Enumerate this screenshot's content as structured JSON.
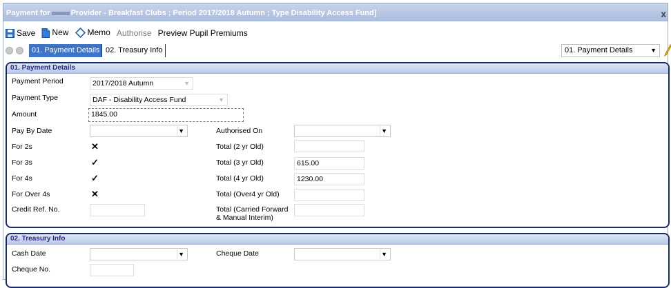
{
  "window": {
    "title_prefix": "Payment for",
    "title_suffix": "Provider - Breakfast Clubs ; Period 2017/2018 Autumn ; Type Disability Access Fund]",
    "close": "x"
  },
  "toolbar": {
    "save": "Save",
    "new": "New",
    "memo": "Memo",
    "authorise": "Authorise",
    "preview": "Preview Pupil Premiums"
  },
  "nav": {
    "tabs": [
      "01. Payment Details",
      "02. Treasury Info"
    ],
    "select_value": "01. Payment Details"
  },
  "payment_details": {
    "header": "01. Payment Details",
    "payment_period": {
      "label": "Payment Period",
      "value": "2017/2018 Autumn"
    },
    "payment_type": {
      "label": "Payment Type",
      "value": "DAF - Disability Access Fund"
    },
    "amount": {
      "label": "Amount",
      "value": "1845.00"
    },
    "pay_by_date": {
      "label": "Pay By Date",
      "value": ""
    },
    "authorised_on": {
      "label": "Authorised On",
      "value": ""
    },
    "for_2s": {
      "label": "For 2s",
      "checked": false
    },
    "for_3s": {
      "label": "For 3s",
      "checked": true
    },
    "for_4s": {
      "label": "For 4s",
      "checked": true
    },
    "for_over_4s": {
      "label": "For Over 4s",
      "checked": false
    },
    "total_2yr": {
      "label": "Total (2 yr Old)",
      "value": ""
    },
    "total_3yr": {
      "label": "Total (3 yr Old)",
      "value": "615.00"
    },
    "total_4yr": {
      "label": "Total (4 yr Old)",
      "value": "1230.00"
    },
    "total_over4": {
      "label": "Total (Over4 yr Old)",
      "value": ""
    },
    "credit_ref": {
      "label": "Credit Ref. No.",
      "value": ""
    },
    "total_cf_line1": "Total (Carried Forward",
    "total_cf_line2": "& Manual Interim)",
    "total_cf_value": ""
  },
  "treasury": {
    "header": "02. Treasury Info",
    "cash_date": {
      "label": "Cash Date",
      "value": ""
    },
    "cheque_date": {
      "label": "Cheque Date",
      "value": ""
    },
    "cheque_no": {
      "label": "Cheque No.",
      "value": ""
    }
  },
  "marks": {
    "tick": "✓",
    "cross": "✕",
    "dropdown": "▼"
  },
  "colors": {
    "title_bar": "#b4c4e4",
    "active_tab": "#3f73c3",
    "panel_border": "#1a2a66"
  }
}
